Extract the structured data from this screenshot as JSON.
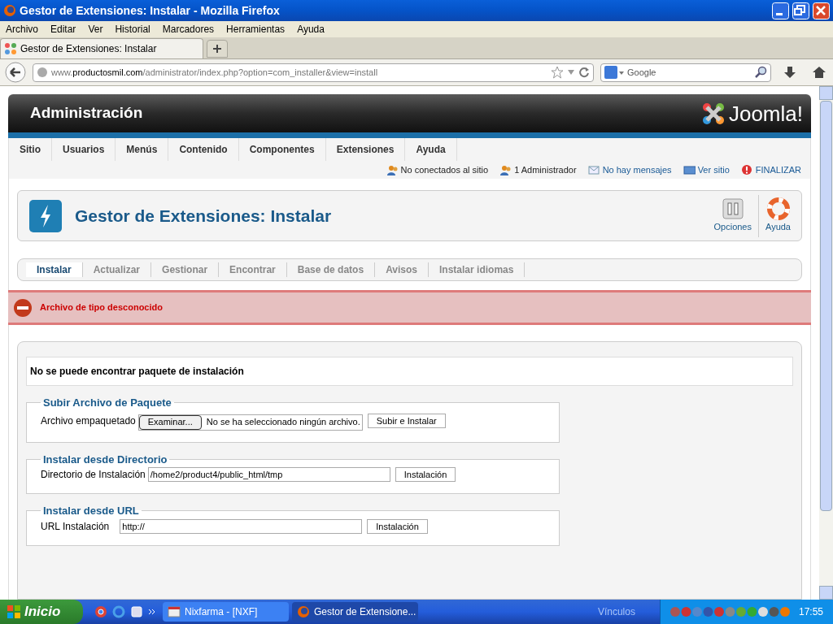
{
  "window": {
    "title": "Gestor de Extensiones: Instalar - Mozilla Firefox"
  },
  "menu_bar": [
    "Archivo",
    "Editar",
    "Ver",
    "Historial",
    "Marcadores",
    "Herramientas",
    "Ayuda"
  ],
  "browser_tabs": [
    {
      "label": "Gestor de Extensiones: Instalar",
      "selected": true
    }
  ],
  "address_bar": {
    "url_prefix": "www.",
    "url_domain": "productosmil.com",
    "url_path": "/administrator/index.php?option=com_installer&view=install"
  },
  "search": {
    "placeholder": "Google"
  },
  "admin_header": {
    "title": "Administración",
    "logo_text": "Joomla!"
  },
  "main_menu": [
    "Sitio",
    "Usuarios",
    "Menús",
    "Contenido",
    "Componentes",
    "Extensiones",
    "Ayuda"
  ],
  "status_items": [
    {
      "kind": "users",
      "label": "No conectados al sitio"
    },
    {
      "kind": "users",
      "label": "1 Administrador"
    },
    {
      "kind": "messages",
      "label": "No hay mensajes"
    },
    {
      "kind": "site",
      "label": "Ver sitio"
    },
    {
      "kind": "logout",
      "label": "FINALIZAR"
    }
  ],
  "toolbar": {
    "title": "Gestor de Extensiones: Instalar",
    "buttons": [
      {
        "kind": "options",
        "label": "Opciones"
      },
      {
        "kind": "help",
        "label": "Ayuda"
      }
    ]
  },
  "submenu": [
    {
      "label": "Instalar",
      "selected": true
    },
    {
      "label": "Actualizar",
      "selected": false
    },
    {
      "label": "Gestionar",
      "selected": false
    },
    {
      "label": "Encontrar",
      "selected": false
    },
    {
      "label": "Base de datos",
      "selected": false
    },
    {
      "label": "Avisos",
      "selected": false
    },
    {
      "label": "Instalar idiomas",
      "selected": false
    }
  ],
  "error_message": "Archivo de tipo desconocido",
  "install_panel": {
    "message": "No se puede encontrar paquete de instalación",
    "sections": [
      {
        "kind": "upload",
        "legend": "Subir Archivo de Paquete",
        "label": "Archivo empaquetado",
        "browse_button": "Examinar...",
        "file_status": "No se ha seleccionado ningún archivo.",
        "submit": "Subir e Instalar"
      },
      {
        "kind": "directory",
        "legend": "Instalar desde Directorio",
        "label": "Directorio de Instalación",
        "value": "/home2/product4/public_html/tmp",
        "submit": "Instalación"
      },
      {
        "kind": "url",
        "legend": "Instalar desde URL",
        "label": "URL Instalación",
        "value": "http://",
        "submit": "Instalación"
      }
    ]
  },
  "taskbar": {
    "start": "Inicio",
    "tasks": [
      {
        "label": "Nixfarma - [NXF]",
        "selected": false
      },
      {
        "label": "Gestor de Extensione...",
        "selected": true
      }
    ],
    "links_label": "Vínculos",
    "time": "17:55"
  }
}
